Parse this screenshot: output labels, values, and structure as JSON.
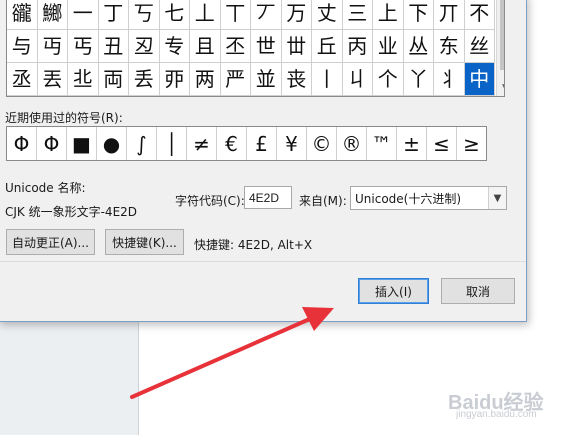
{
  "symbol_grid": {
    "rows": [
      [
        "豅",
        "鱜",
        "一",
        "丁",
        "丂",
        "七",
        "丄",
        "丅",
        "丆",
        "万",
        "丈",
        "三",
        "上",
        "下",
        "丌",
        "不"
      ],
      [
        "与",
        "丏",
        "丐",
        "丑",
        "丒",
        "专",
        "且",
        "丕",
        "世",
        "丗",
        "丘",
        "丙",
        "业",
        "丛",
        "东",
        "丝"
      ],
      [
        "丞",
        "丟",
        "丠",
        "両",
        "丢",
        "丣",
        "两",
        "严",
        "並",
        "丧",
        "丨",
        "丩",
        "个",
        "丫",
        "丬",
        "中"
      ]
    ],
    "selected": "中"
  },
  "recent": {
    "label": "近期使用过的符号(R):",
    "symbols": [
      "Φ",
      "Φ",
      "■",
      "●",
      "∫",
      "│",
      "≠",
      "€",
      "£",
      "¥",
      "©",
      "®",
      "™",
      "±",
      "≤",
      "≥"
    ]
  },
  "unicode_name_label": "Unicode 名称:",
  "unicode_name_value": "CJK 统一象形文字-4E2D",
  "char_code_label": "字符代码(C):",
  "char_code_value": "4E2D",
  "from_label": "来自(M):",
  "from_value": "Unicode(十六进制)",
  "autocorrect_button": "自动更正(A)...",
  "shortcut_button": "快捷键(K)...",
  "shortcut_text": "快捷键: 4E2D, Alt+X",
  "insert_button": "插入(I)",
  "cancel_button": "取消",
  "watermark": "Baidu经验",
  "watermark_sub": "jingyan.baidu.com",
  "colors": {
    "arrow": "#e8323a",
    "selection": "#0a64c8"
  }
}
